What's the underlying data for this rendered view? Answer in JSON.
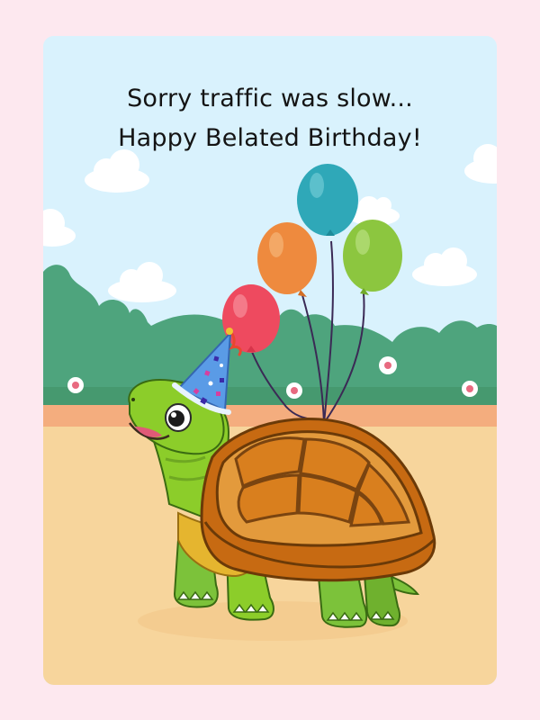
{
  "card": {
    "line1": "Sorry traffic was slow...",
    "line2": "Happy Belated Birthday!"
  },
  "illustration": {
    "subject": "turtle-icon",
    "accessories": [
      "party-hat-icon"
    ],
    "balloons": [
      {
        "name": "balloon-red",
        "color": "#ee4a5f"
      },
      {
        "name": "balloon-orange",
        "color": "#ee8a3e"
      },
      {
        "name": "balloon-teal",
        "color": "#2fa8b8"
      },
      {
        "name": "balloon-green",
        "color": "#8cc63f"
      }
    ]
  },
  "colors": {
    "page_background": "#fde8ef",
    "sky": "#d9f2fd",
    "hedge": "#4ea47d",
    "ground": "#f7d59c",
    "path_stripe": "#f4ad7e",
    "shell": "#d97f1e",
    "turtle_skin": "#8ccd2a"
  }
}
